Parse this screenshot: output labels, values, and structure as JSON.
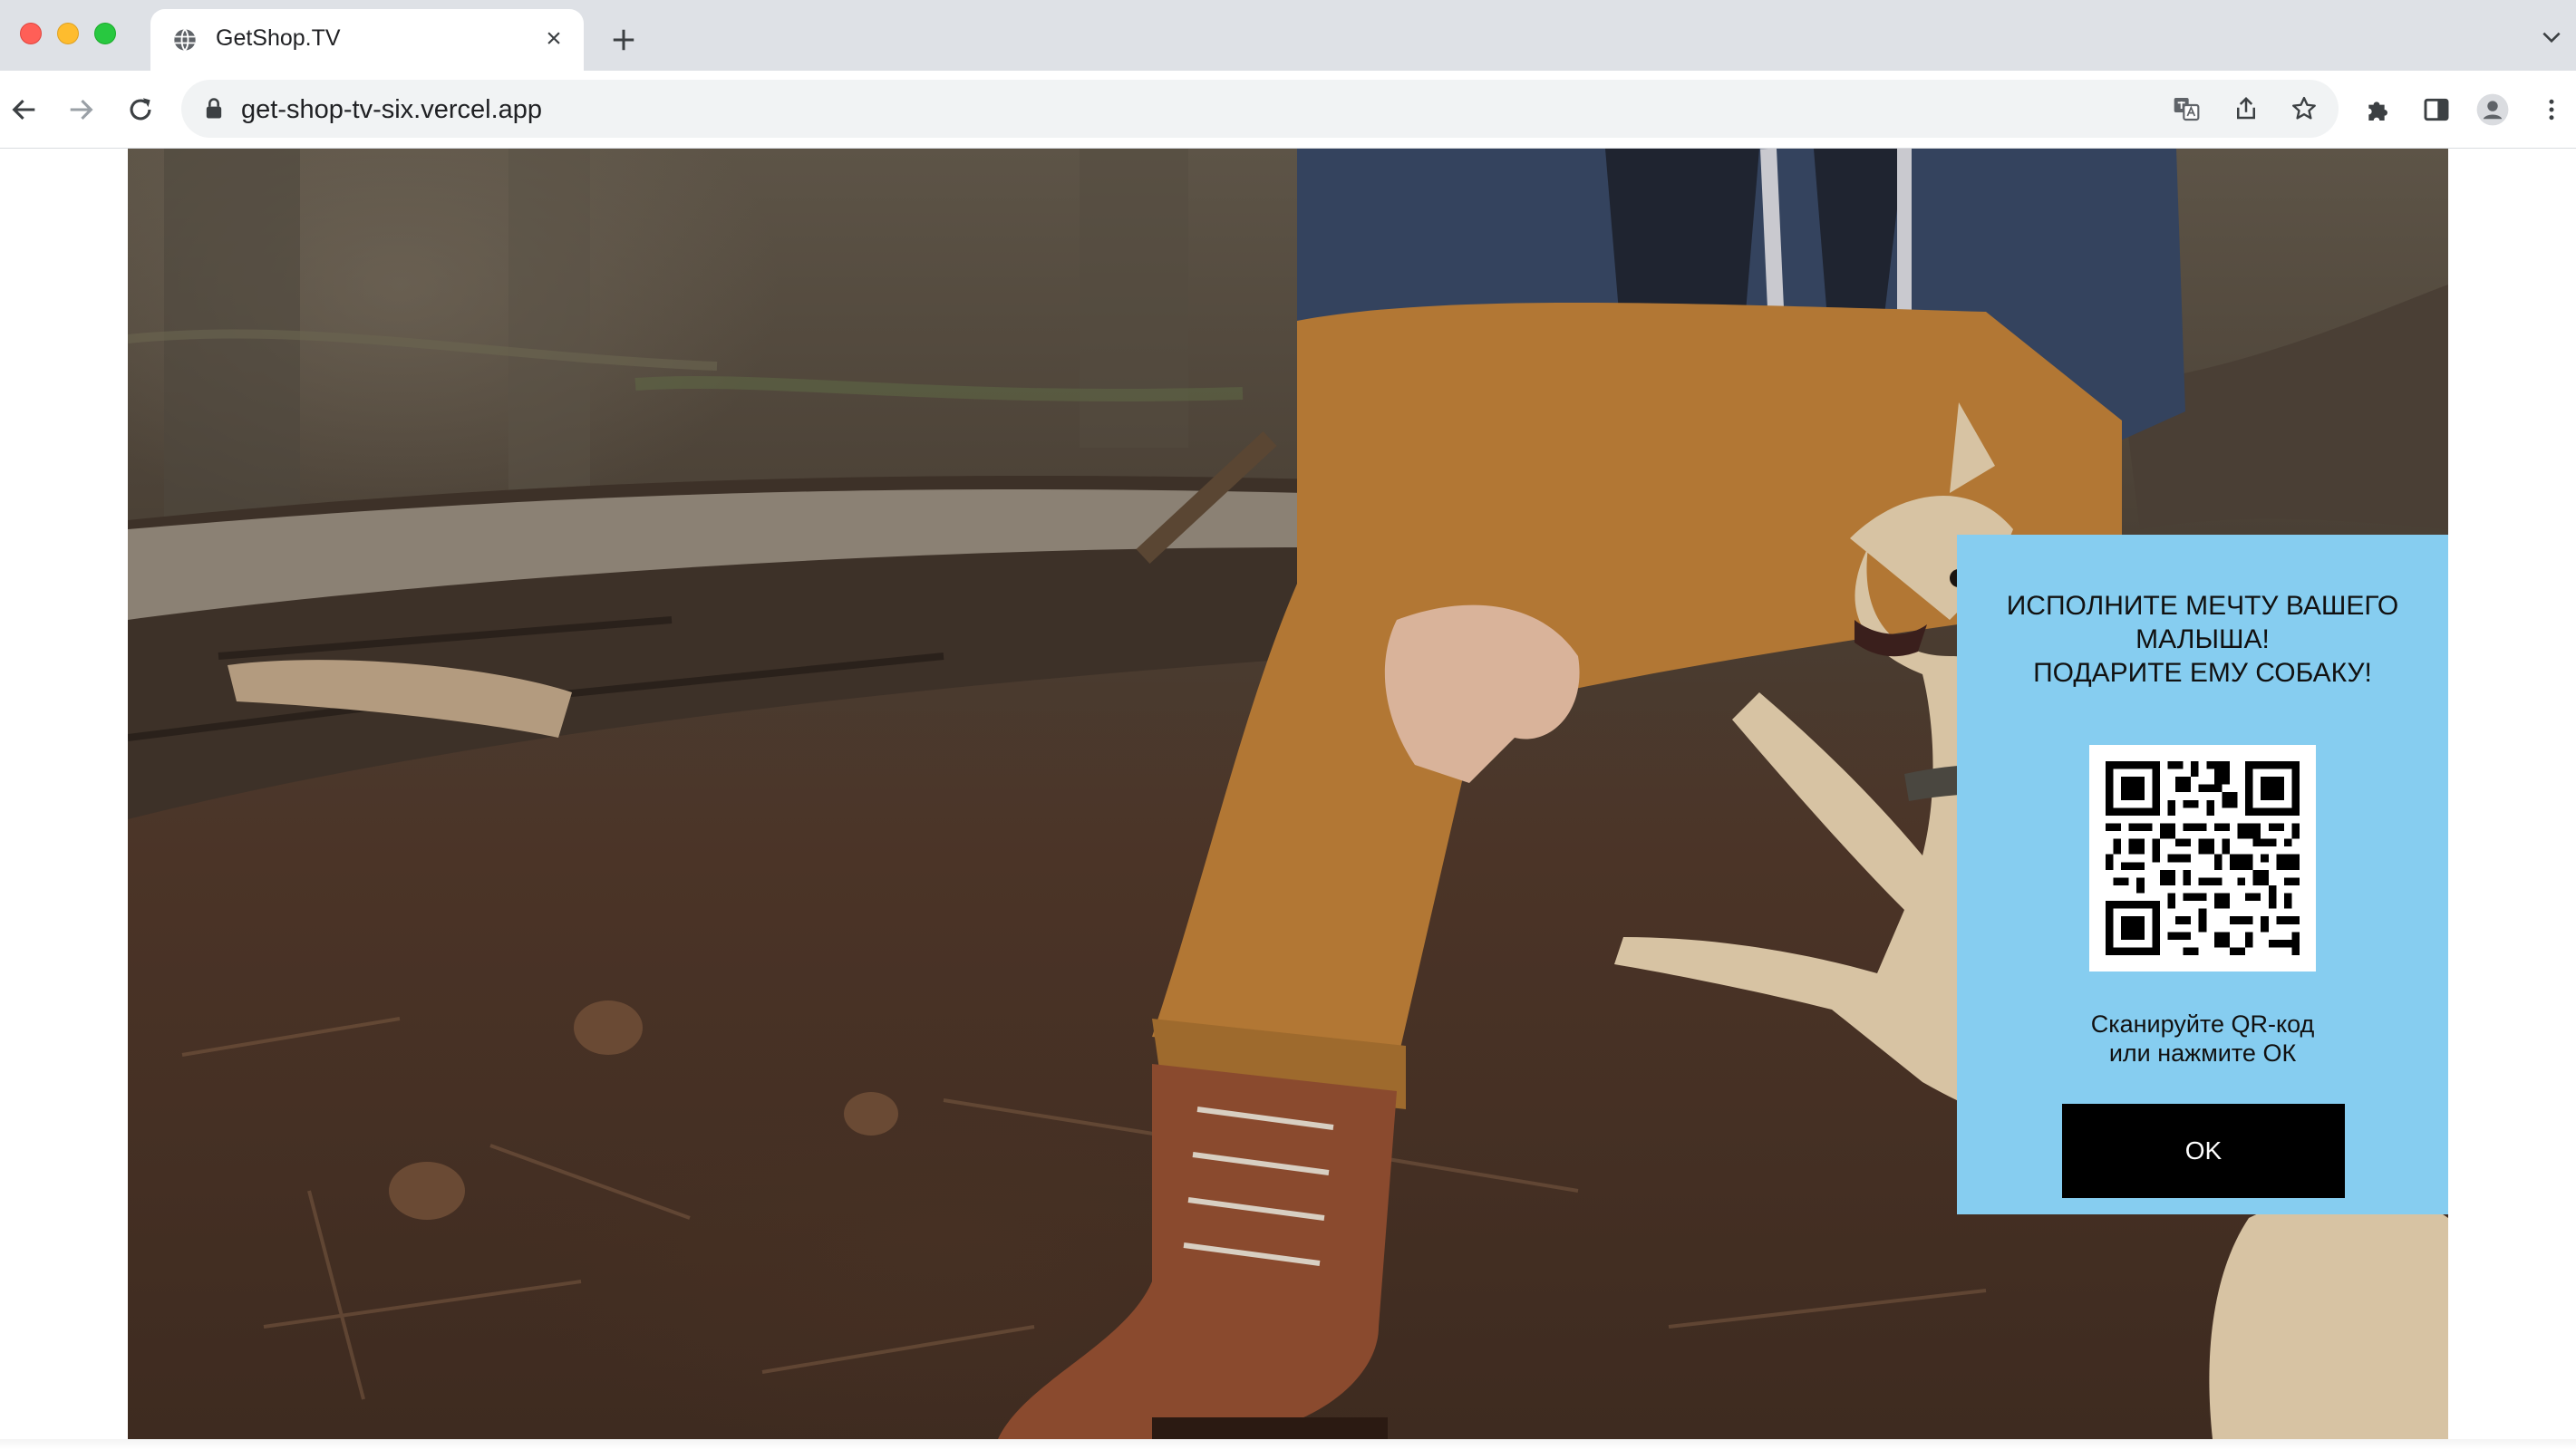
{
  "browser": {
    "tab": {
      "title": "GetShop.TV",
      "favicon": "globe-icon",
      "close_symbol": "×"
    },
    "address_bar": {
      "url": "get-shop-tv-six.vercel.app",
      "security_icon": "lock-icon"
    },
    "toolbar_icons": [
      "back-arrow-icon",
      "forward-arrow-icon",
      "reload-icon",
      "translate-icon",
      "share-icon",
      "bookmark-star-icon",
      "extensions-puzzle-icon",
      "side-panel-icon",
      "profile-avatar-icon",
      "kebab-menu-icon"
    ]
  },
  "promo": {
    "title_lines": [
      "ИСПОЛНИТЕ МЕЧТУ ВАШЕГО",
      "МАЛЫША!",
      "ПОДАРИТЕ ЕМУ СОБАКУ!"
    ],
    "hint_lines": [
      "Сканируйте QR-код",
      "или нажмите ОК"
    ],
    "ok_label": "OK",
    "background_color": "#86cdf0",
    "button_color": "#000000"
  },
  "video": {
    "content": "forest-scene-man-with-dog",
    "colors": {
      "forest_floor": "#3e2b20",
      "trousers": "#b27734",
      "jacket": "#34435e",
      "dog": "#d7c3a3"
    }
  }
}
